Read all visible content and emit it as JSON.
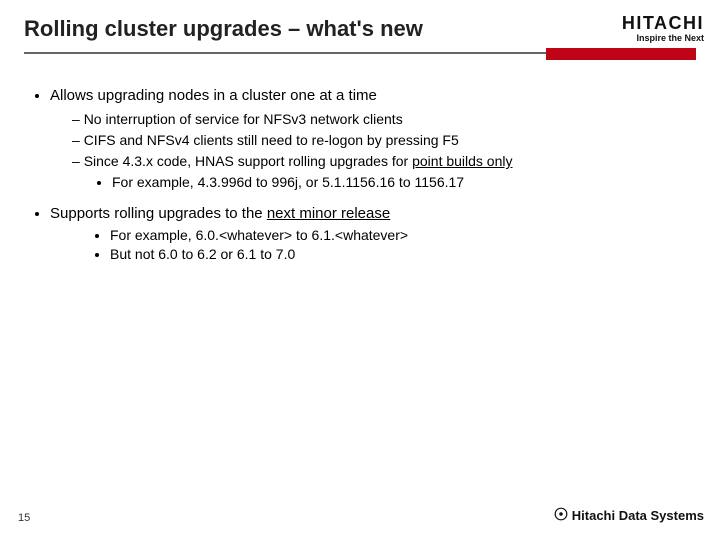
{
  "title": "Rolling cluster upgrades – what's new",
  "logo": {
    "main": "HITACHI",
    "tag": "Inspire the Next"
  },
  "b1": {
    "text": "Allows upgrading nodes in a cluster one at a time",
    "sub": [
      "No interruption of service for NFSv3 network clients",
      "CIFS and NFSv4 clients still need to re-logon by pressing F5"
    ],
    "sub3_pre": "Since 4.3.x code, HNAS support rolling upgrades for ",
    "sub3_underline": "point builds only",
    "sub3_ex": "For example, 4.3.996d to 996j, or 5.1.1156.16 to 1156.17"
  },
  "b2": {
    "pre": "Supports rolling upgrades to the ",
    "underline": "next minor release",
    "examples": [
      "For example, 6.0.<whatever> to 6.1.<whatever>",
      "But not 6.0 to 6.2 or 6.1 to 7.0"
    ]
  },
  "pagenum": "15",
  "footer_brand": "Hitachi Data Systems"
}
